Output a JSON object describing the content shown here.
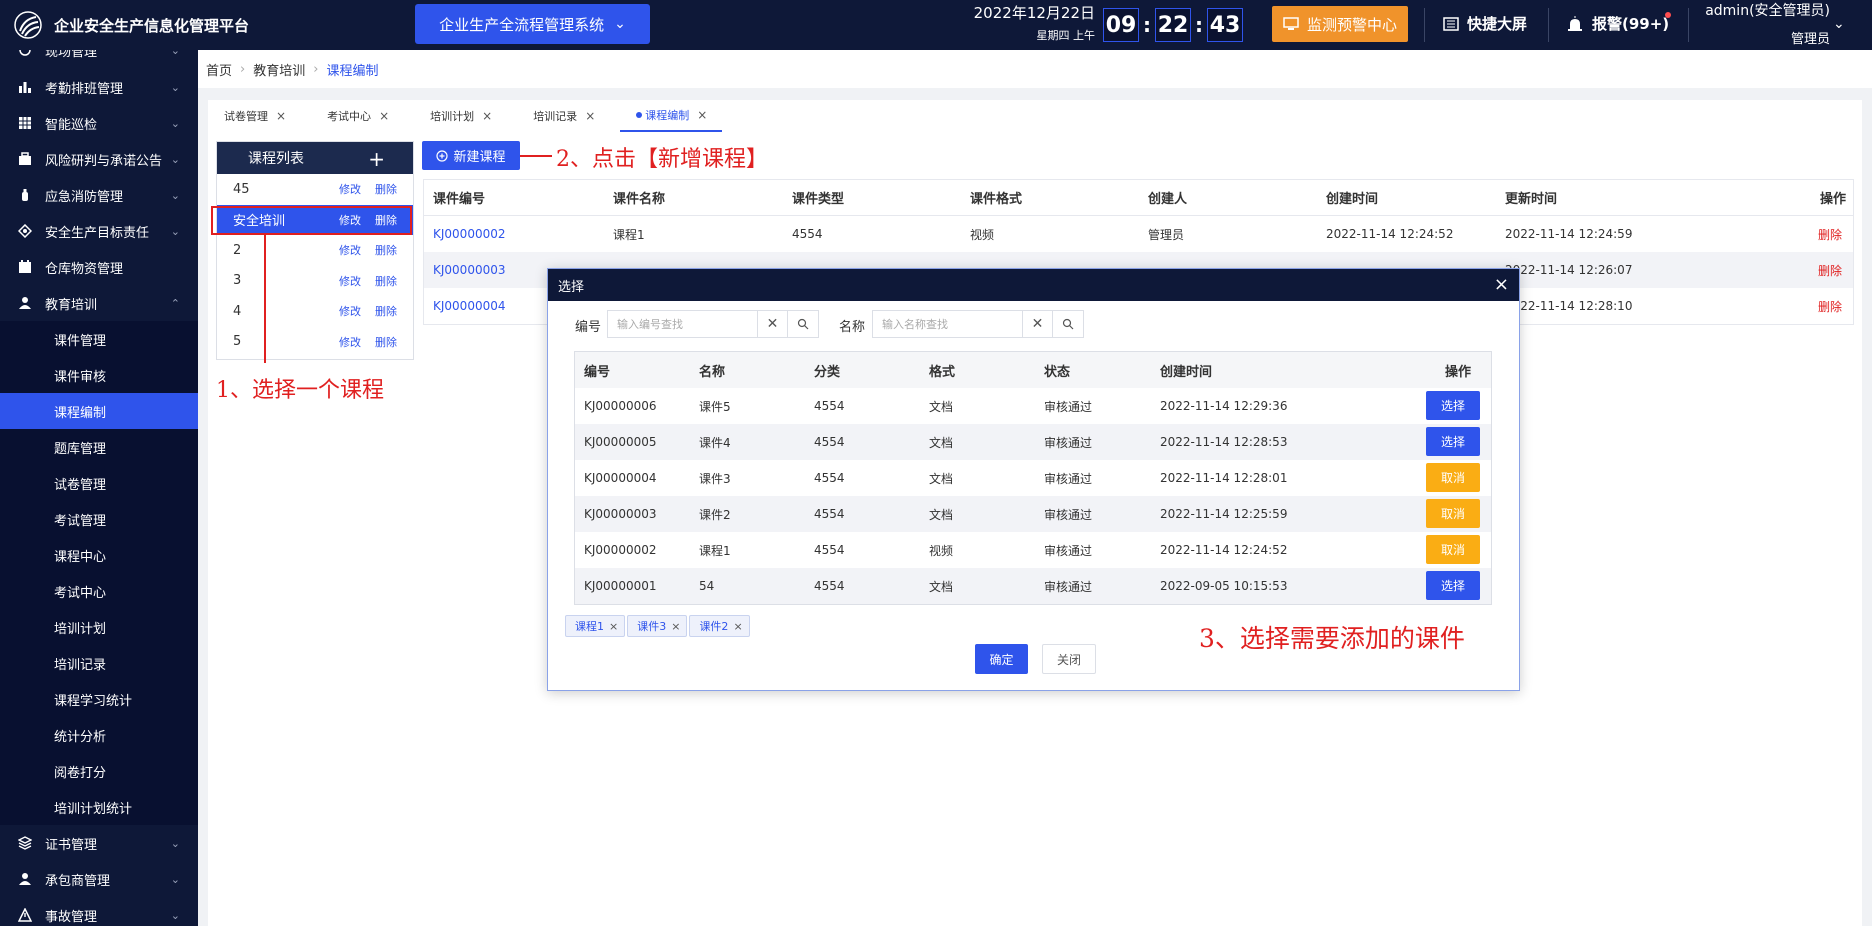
{
  "header": {
    "app_title": "企业安全生产信息化管理平台",
    "system_select": "企业生产全流程管理系统",
    "date_main": "2022年12月22日",
    "date_sub": "星期四  上午",
    "clock": {
      "hour": "09",
      "minute": "22",
      "second": "43"
    },
    "monitor_label": "监测预警中心",
    "bigscreen_label": "快捷大屏",
    "alarm_label": "报警(99+)",
    "user_name": "admin(安全管理员)",
    "user_role": "管理员"
  },
  "sidebar": {
    "items": [
      {
        "label": "现场管理",
        "icon": "map-icon"
      },
      {
        "label": "考勤排班管理",
        "icon": "bar-chart-icon"
      },
      {
        "label": "智能巡检",
        "icon": "grid-icon"
      },
      {
        "label": "风险研判与承诺公告",
        "icon": "briefcase-icon"
      },
      {
        "label": "应急消防管理",
        "icon": "extinguisher-icon"
      },
      {
        "label": "安全生产目标责任",
        "icon": "target-icon"
      },
      {
        "label": "仓库物资管理",
        "icon": "calendar-icon"
      },
      {
        "label": "教育培训",
        "icon": "user-icon"
      }
    ],
    "sub_items": [
      {
        "label": "课件管理"
      },
      {
        "label": "课件审核"
      },
      {
        "label": "课程编制"
      },
      {
        "label": "题库管理"
      },
      {
        "label": "试卷管理"
      },
      {
        "label": "考试管理"
      },
      {
        "label": "课程中心"
      },
      {
        "label": "考试中心"
      },
      {
        "label": "培训计划"
      },
      {
        "label": "培训记录"
      },
      {
        "label": "课程学习统计"
      },
      {
        "label": "统计分析"
      },
      {
        "label": "阅卷打分"
      },
      {
        "label": "培训计划统计"
      }
    ],
    "bottom_items": [
      {
        "label": "证书管理",
        "icon": "layers-icon"
      },
      {
        "label": "承包商管理",
        "icon": "user-icon"
      },
      {
        "label": "事故管理",
        "icon": "warning-icon"
      }
    ]
  },
  "breadcrumb": {
    "home": "首页",
    "section": "教育培训",
    "current": "课程编制"
  },
  "tabs": [
    {
      "label": "试卷管理"
    },
    {
      "label": "考试中心"
    },
    {
      "label": "培训计划"
    },
    {
      "label": "培训记录"
    },
    {
      "label": "课程编制"
    }
  ],
  "course_list": {
    "title": "课程列表",
    "edit_label": "修改",
    "delete_label": "删除",
    "rows": [
      "45",
      "安全培训",
      "2",
      "3",
      "4",
      "5"
    ]
  },
  "new_course_button": "新建课程",
  "annotations": {
    "step1": "1、选择一个课程",
    "step2": "2、点击【新增课程】",
    "step3": "3、选择需要添加的课件"
  },
  "main_table": {
    "headers": [
      "课件编号",
      "课件名称",
      "课件类型",
      "课件格式",
      "创建人",
      "创建时间",
      "更新时间",
      "操作"
    ],
    "delete_label": "删除",
    "rows": [
      {
        "code": "KJ00000002",
        "name": "课程1",
        "type": "4554",
        "format": "视频",
        "creator": "管理员",
        "created": "2022-11-14 12:24:52",
        "updated": "2022-11-14 12:24:59"
      },
      {
        "code": "KJ00000003",
        "name": "",
        "type": "",
        "format": "",
        "creator": "",
        "created": "",
        "updated": "2022-11-14 12:26:07"
      },
      {
        "code": "KJ00000004",
        "name": "",
        "type": "",
        "format": "",
        "creator": "",
        "created": "",
        "updated": "2022-11-14 12:28:10"
      }
    ]
  },
  "modal": {
    "title": "选择",
    "code_label": "编号",
    "code_placeholder": "输入编号查找",
    "name_label": "名称",
    "name_placeholder": "输入名称查找",
    "headers": [
      "编号",
      "名称",
      "分类",
      "格式",
      "状态",
      "创建时间",
      "操作"
    ],
    "rows": [
      {
        "code": "KJ00000006",
        "name": "课件5",
        "category": "4554",
        "format": "文档",
        "status": "审核通过",
        "created": "2022-11-14 12:29:36",
        "action": "选择",
        "action_type": "select"
      },
      {
        "code": "KJ00000005",
        "name": "课件4",
        "category": "4554",
        "format": "文档",
        "status": "审核通过",
        "created": "2022-11-14 12:28:53",
        "action": "选择",
        "action_type": "select"
      },
      {
        "code": "KJ00000004",
        "name": "课件3",
        "category": "4554",
        "format": "文档",
        "status": "审核通过",
        "created": "2022-11-14 12:28:01",
        "action": "取消",
        "action_type": "cancel"
      },
      {
        "code": "KJ00000003",
        "name": "课件2",
        "category": "4554",
        "format": "文档",
        "status": "审核通过",
        "created": "2022-11-14 12:25:59",
        "action": "取消",
        "action_type": "cancel"
      },
      {
        "code": "KJ00000002",
        "name": "课程1",
        "category": "4554",
        "format": "视频",
        "status": "审核通过",
        "created": "2022-11-14 12:24:52",
        "action": "取消",
        "action_type": "cancel"
      },
      {
        "code": "KJ00000001",
        "name": "54",
        "category": "4554",
        "format": "文档",
        "status": "审核通过",
        "created": "2022-09-05 10:15:53",
        "action": "选择",
        "action_type": "select"
      }
    ],
    "chips": [
      "课程1",
      "课件3",
      "课件2"
    ],
    "confirm_label": "确定",
    "close_label": "关闭"
  },
  "colors": {
    "primary": "#2f54eb",
    "sidebar_bg": "#0e1838",
    "warning": "#faad14",
    "orange": "#f0932b",
    "annotation_red": "#e02020"
  }
}
